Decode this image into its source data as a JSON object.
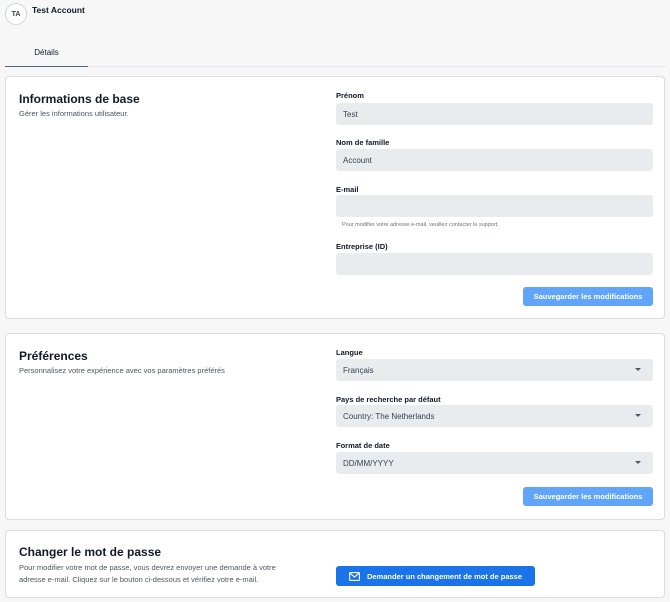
{
  "header": {
    "avatar_initials": "TA",
    "account_name": "Test Account"
  },
  "tabs": [
    {
      "label": "Détails"
    }
  ],
  "basic_info": {
    "title": "Informations de base",
    "subtitle": "Gérer les informations utilisateur.",
    "first_name": {
      "label": "Prénom",
      "value": "Test"
    },
    "last_name": {
      "label": "Nom de famille",
      "value": "Account"
    },
    "email": {
      "label": "E-mail",
      "value": "",
      "hint": "Pour modifier votre adresse e-mail, veuillez contacter le support."
    },
    "company": {
      "label": "Entreprise (ID)",
      "value": ""
    },
    "save_label": "Sauvegarder les modifications"
  },
  "preferences": {
    "title": "Préférences",
    "subtitle": "Personnalisez votre expérience avec vos paramètres préférés",
    "language": {
      "label": "Langue",
      "value": "Français"
    },
    "search_country": {
      "label": "Pays de recherche par défaut",
      "value": "Country: The Netherlands"
    },
    "date_format": {
      "label": "Format de date",
      "value": "DD/MM/YYYY"
    },
    "save_label": "Sauvegarder les modifications"
  },
  "password": {
    "title": "Changer le mot de passe",
    "description_line1": "Pour modifier votre mot de passe, vous devrez envoyer une demande à votre",
    "description_line2": "adresse e-mail. Cliquez sur le bouton ci-dessous et vérifiez votre e-mail.",
    "button_label": "Demander un changement de mot de passe",
    "button_icon": "mail-icon"
  },
  "colors": {
    "accent_primary": "#1a73e8",
    "accent_light": "#60a5fa",
    "input_bg": "#e9ecef",
    "tab_underline": "#4b6b8a"
  }
}
